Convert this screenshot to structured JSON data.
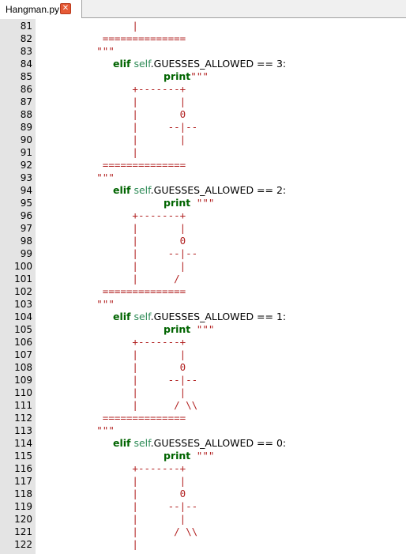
{
  "tab": {
    "title": "Hangman.py",
    "close_glyph": "✕"
  },
  "colors": {
    "keyword": "#006400",
    "self": "#2e8b57",
    "string": "#b22222",
    "gutter": "#e4e4e4"
  },
  "lines": [
    {
      "n": "81",
      "indent": "                ",
      "tokens": [
        {
          "t": "str",
          "v": "|"
        }
      ]
    },
    {
      "n": "82",
      "indent": "           ",
      "tokens": [
        {
          "t": "str",
          "v": "=============="
        }
      ]
    },
    {
      "n": "83",
      "indent": "          ",
      "tokens": [
        {
          "t": "str",
          "v": "\"\"\""
        }
      ]
    },
    {
      "n": "84",
      "indent": "",
      "tokens": [
        {
          "t": "kw",
          "v": "elif"
        },
        {
          "t": "ident",
          "v": " "
        },
        {
          "t": "self",
          "v": "self"
        },
        {
          "t": "ident",
          "v": ".GUESSES_ALLOWED"
        },
        {
          "t": "op",
          "v": " == "
        },
        {
          "t": "ident",
          "v": "3:"
        }
      ]
    },
    {
      "n": "85",
      "indent": "",
      "tokens": [
        {
          "t": "kw",
          "v": "print"
        },
        {
          "t": "str",
          "v": "\"\"\""
        }
      ]
    },
    {
      "n": "86",
      "indent": "                ",
      "tokens": [
        {
          "t": "str",
          "v": "+-------+"
        }
      ]
    },
    {
      "n": "87",
      "indent": "                ",
      "tokens": [
        {
          "t": "str",
          "v": "|       |"
        }
      ]
    },
    {
      "n": "88",
      "indent": "                ",
      "tokens": [
        {
          "t": "str",
          "v": "|       0"
        }
      ]
    },
    {
      "n": "89",
      "indent": "                ",
      "tokens": [
        {
          "t": "str",
          "v": "|     --|--"
        }
      ]
    },
    {
      "n": "90",
      "indent": "                ",
      "tokens": [
        {
          "t": "str",
          "v": "|       |"
        }
      ]
    },
    {
      "n": "91",
      "indent": "                ",
      "tokens": [
        {
          "t": "str",
          "v": "|"
        }
      ]
    },
    {
      "n": "92",
      "indent": "           ",
      "tokens": [
        {
          "t": "str",
          "v": "=============="
        }
      ]
    },
    {
      "n": "93",
      "indent": "          ",
      "tokens": [
        {
          "t": "str",
          "v": "\"\"\""
        }
      ]
    },
    {
      "n": "94",
      "indent": "",
      "tokens": [
        {
          "t": "kw",
          "v": "elif"
        },
        {
          "t": "ident",
          "v": " "
        },
        {
          "t": "self",
          "v": "self"
        },
        {
          "t": "ident",
          "v": ".GUESSES_ALLOWED"
        },
        {
          "t": "op",
          "v": " == "
        },
        {
          "t": "ident",
          "v": "2:"
        }
      ]
    },
    {
      "n": "95",
      "indent": "",
      "tokens": [
        {
          "t": "kw",
          "v": "print"
        },
        {
          "t": "str",
          "v": " \"\"\""
        }
      ]
    },
    {
      "n": "96",
      "indent": "                ",
      "tokens": [
        {
          "t": "str",
          "v": "+-------+"
        }
      ]
    },
    {
      "n": "97",
      "indent": "                ",
      "tokens": [
        {
          "t": "str",
          "v": "|       |"
        }
      ]
    },
    {
      "n": "98",
      "indent": "                ",
      "tokens": [
        {
          "t": "str",
          "v": "|       0"
        }
      ]
    },
    {
      "n": "99",
      "indent": "                ",
      "tokens": [
        {
          "t": "str",
          "v": "|     --|--"
        }
      ]
    },
    {
      "n": "100",
      "indent": "                ",
      "tokens": [
        {
          "t": "str",
          "v": "|       |"
        }
      ]
    },
    {
      "n": "101",
      "indent": "                ",
      "tokens": [
        {
          "t": "str",
          "v": "|      /"
        }
      ]
    },
    {
      "n": "102",
      "indent": "           ",
      "tokens": [
        {
          "t": "str",
          "v": "=============="
        }
      ]
    },
    {
      "n": "103",
      "indent": "          ",
      "tokens": [
        {
          "t": "str",
          "v": "\"\"\""
        }
      ]
    },
    {
      "n": "104",
      "indent": "",
      "tokens": [
        {
          "t": "kw",
          "v": "elif"
        },
        {
          "t": "ident",
          "v": " "
        },
        {
          "t": "self",
          "v": "self"
        },
        {
          "t": "ident",
          "v": ".GUESSES_ALLOWED"
        },
        {
          "t": "op",
          "v": " == "
        },
        {
          "t": "ident",
          "v": "1:"
        }
      ]
    },
    {
      "n": "105",
      "indent": "",
      "tokens": [
        {
          "t": "kw",
          "v": "print"
        },
        {
          "t": "str",
          "v": " \"\"\""
        }
      ]
    },
    {
      "n": "106",
      "indent": "                ",
      "tokens": [
        {
          "t": "str",
          "v": "+-------+"
        }
      ]
    },
    {
      "n": "107",
      "indent": "                ",
      "tokens": [
        {
          "t": "str",
          "v": "|       |"
        }
      ]
    },
    {
      "n": "108",
      "indent": "                ",
      "tokens": [
        {
          "t": "str",
          "v": "|       0"
        }
      ]
    },
    {
      "n": "109",
      "indent": "                ",
      "tokens": [
        {
          "t": "str",
          "v": "|     --|--"
        }
      ]
    },
    {
      "n": "110",
      "indent": "                ",
      "tokens": [
        {
          "t": "str",
          "v": "|       |"
        }
      ]
    },
    {
      "n": "111",
      "indent": "                ",
      "tokens": [
        {
          "t": "str",
          "v": "|      / \\\\"
        }
      ]
    },
    {
      "n": "112",
      "indent": "           ",
      "tokens": [
        {
          "t": "str",
          "v": "=============="
        }
      ]
    },
    {
      "n": "113",
      "indent": "          ",
      "tokens": [
        {
          "t": "str",
          "v": "\"\"\""
        }
      ]
    },
    {
      "n": "114",
      "indent": "",
      "tokens": [
        {
          "t": "kw",
          "v": "elif"
        },
        {
          "t": "ident",
          "v": " "
        },
        {
          "t": "self",
          "v": "self"
        },
        {
          "t": "ident",
          "v": ".GUESSES_ALLOWED"
        },
        {
          "t": "op",
          "v": " == "
        },
        {
          "t": "ident",
          "v": "0:"
        }
      ]
    },
    {
      "n": "115",
      "indent": "",
      "tokens": [
        {
          "t": "kw",
          "v": "print"
        },
        {
          "t": "str",
          "v": " \"\"\""
        }
      ]
    },
    {
      "n": "116",
      "indent": "                ",
      "tokens": [
        {
          "t": "str",
          "v": "+-------+"
        }
      ]
    },
    {
      "n": "117",
      "indent": "                ",
      "tokens": [
        {
          "t": "str",
          "v": "|       |"
        }
      ]
    },
    {
      "n": "118",
      "indent": "                ",
      "tokens": [
        {
          "t": "str",
          "v": "|       0"
        }
      ]
    },
    {
      "n": "119",
      "indent": "                ",
      "tokens": [
        {
          "t": "str",
          "v": "|     --|--"
        }
      ]
    },
    {
      "n": "120",
      "indent": "                ",
      "tokens": [
        {
          "t": "str",
          "v": "|       |"
        }
      ]
    },
    {
      "n": "121",
      "indent": "                ",
      "tokens": [
        {
          "t": "str",
          "v": "|      / \\\\"
        }
      ]
    },
    {
      "n": "122",
      "indent": "                ",
      "tokens": [
        {
          "t": "str",
          "v": "|"
        }
      ]
    }
  ]
}
